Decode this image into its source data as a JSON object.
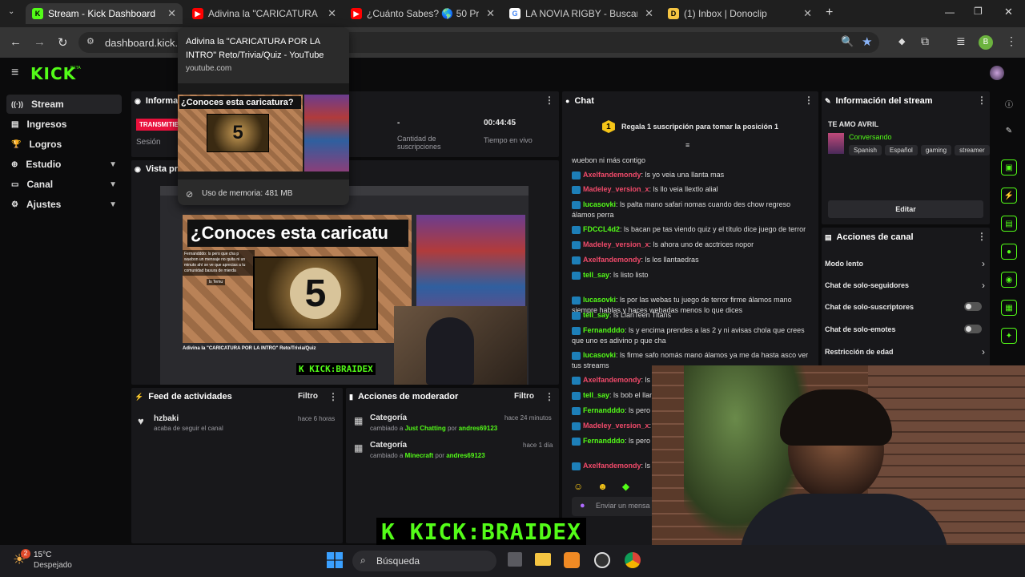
{
  "tabs": [
    {
      "title": "Stream - Kick Dashboard",
      "icon": "kick-icon"
    },
    {
      "title": "Adivina la \"CARICATURA POR L",
      "icon": "youtube-icon"
    },
    {
      "title": "¿Cuánto Sabes? 🌎 50 Pregunt",
      "icon": "youtube-icon"
    },
    {
      "title": "LA NOVIA RIGBY - Buscar con G",
      "icon": "google-icon"
    },
    {
      "title": "(1) Inbox | Donoclip",
      "icon": "donoclip-icon"
    }
  ],
  "address": {
    "url": "dashboard.kick.co"
  },
  "tooltip": {
    "title": "Adivina la \"CARICATURA POR LA INTRO\" Reto/Trivia/Quiz - YouTube",
    "domain": "youtube.com",
    "thumb_text": "¿Conoces esta caricatura?",
    "thumb_number": "5",
    "memory": "Uso de memoria: 481 MB"
  },
  "kick": {
    "logo": "KICK",
    "beta": "BETA"
  },
  "sidebar": [
    {
      "label": "Stream",
      "icon": "stream-icon",
      "active": true
    },
    {
      "label": "Ingresos",
      "icon": "income-icon"
    },
    {
      "label": "Logros",
      "icon": "trophy-icon"
    },
    {
      "label": "Estudio",
      "icon": "studio-icon",
      "chevron": true
    },
    {
      "label": "Canal",
      "icon": "channel-icon",
      "chevron": true
    },
    {
      "label": "Ajustes",
      "icon": "settings-icon",
      "chevron": true
    }
  ],
  "info_panel": {
    "title": "Informació",
    "live_badge": "TRANSMITIEN",
    "session_label": "Sesión",
    "subs_value": "-",
    "subs_label": "Cantidad de suscripciones",
    "time_value": "00:44:45",
    "time_label": "Tiempo en vivo"
  },
  "preview": {
    "title": "Vista prev",
    "yt_heading": "¿Conoces esta caricatu",
    "yt_number": "5",
    "yt_video_title": "Adivina la \"CARICATURA POR LA INTRO\" Reto/Trivia/Quiz",
    "overlay": "K KICK:BRAIDEX",
    "comment1": "Fernandddo: ls pero que cha p wuebon un mensaje no quita ni un minuto ahí se ve que aprecias a tu comunidad basura de mierda",
    "comment2": "ls Temu"
  },
  "chat": {
    "title": "Chat",
    "pinned": "Regala 1 suscripción para tomar la posición 1",
    "pinned_number": "1",
    "top_cut": "wuebon ni más contigo",
    "messages": [
      {
        "user": "Axelfandemondy",
        "text": "ls yo veia una llanta mas",
        "color": "#f04a6a"
      },
      {
        "user": "Madeley_version_x",
        "text": "ls llo veia llextlo alial",
        "color": "#f04a6a"
      },
      {
        "user": "lucasovki",
        "text": "ls palta mano safari nomas cuando des chow regreso álamos perra",
        "color": "#53fc18"
      },
      {
        "user": "FDCCL4d2",
        "text": "ls bacan pe tas viendo quiz y el título dice juego de terror",
        "color": "#53fc18"
      },
      {
        "user": "Madeley_version_x",
        "text": "ls ahora uno de acctrices nopor",
        "color": "#f04a6a"
      },
      {
        "user": "Axelfandemondy",
        "text": "ls los llantaedras",
        "color": "#f04a6a"
      },
      {
        "user": "tell_say",
        "text": "ls listo listo",
        "color": "#53fc18"
      },
      {
        "user": "lucasovki",
        "text": "ls por las webas tu juego de terror firme álamos mano siempre hablas y haces webadas menos lo que dices",
        "color": "#53fc18"
      },
      {
        "user": "tell_say",
        "text": "ls LlanTeen Titans",
        "color": "#53fc18"
      },
      {
        "user": "Fernandddo",
        "text": "ls y encima prendes a las 2 y ni avisas chola que crees que uno es adivino p que cha",
        "color": "#53fc18"
      },
      {
        "user": "lucasovki",
        "text": "ls firme safo nomás mano álamos ya me da hasta asco ver tus streams",
        "color": "#53fc18"
      },
      {
        "user": "Axelfandemondy",
        "text": "ls u",
        "color": "#f04a6a"
      },
      {
        "user": "tell_say",
        "text": "ls bob el llant",
        "color": "#53fc18"
      },
      {
        "user": "Fernandddo",
        "text": "ls pero q",
        "color": "#53fc18"
      },
      {
        "user": "Madeley_version_x",
        "text": "ls pero q",
        "color": "#f04a6a"
      },
      {
        "user": "Fernandddo",
        "text": "ls pero q minuto ahí se ve que apre",
        "color": "#53fc18"
      },
      {
        "user": "Axelfandemondy",
        "text": "ls T",
        "color": "#f04a6a"
      }
    ],
    "input_placeholder": "Enviar un mensa"
  },
  "stream_info": {
    "title": "Información del stream",
    "stream_title": "TE AMO AVRIL",
    "category": "Conversando",
    "tags": [
      "Spanish",
      "Español",
      "gaming",
      "streamer"
    ],
    "edit": "Editar"
  },
  "channel_actions": {
    "title": "Acciones de canal",
    "items": [
      {
        "label": "Modo lento",
        "type": "chevron"
      },
      {
        "label": "Chat de solo-seguidores",
        "type": "chevron"
      },
      {
        "label": "Chat de solo-suscriptores",
        "type": "toggle"
      },
      {
        "label": "Chat de solo-emotes",
        "type": "toggle"
      },
      {
        "label": "Restricción de edad",
        "type": "chevron"
      }
    ]
  },
  "feed": {
    "title": "Feed de actividades",
    "filter": "Filtro",
    "item": {
      "user": "hzbaki",
      "text": "acaba de seguir el canal",
      "time": "hace 6 horas"
    }
  },
  "mod": {
    "title": "Acciones de moderador",
    "filter": "Filtro",
    "items": [
      {
        "title": "Categoría",
        "time": "hace 24 minutos",
        "pre": "cambiado a",
        "category": "Just Chatting",
        "by": "por",
        "user": "andres69123"
      },
      {
        "title": "Categoría",
        "time": "hace 1 día",
        "pre": "cambiado a",
        "category": "Minecraft",
        "by": "por",
        "user": "andres69123"
      }
    ]
  },
  "overlay_bottom": "K KICK:BRAIDEX",
  "taskbar": {
    "temp": "15°C",
    "weather": "Despejado",
    "search": "Búsqueda",
    "badge": "2"
  }
}
